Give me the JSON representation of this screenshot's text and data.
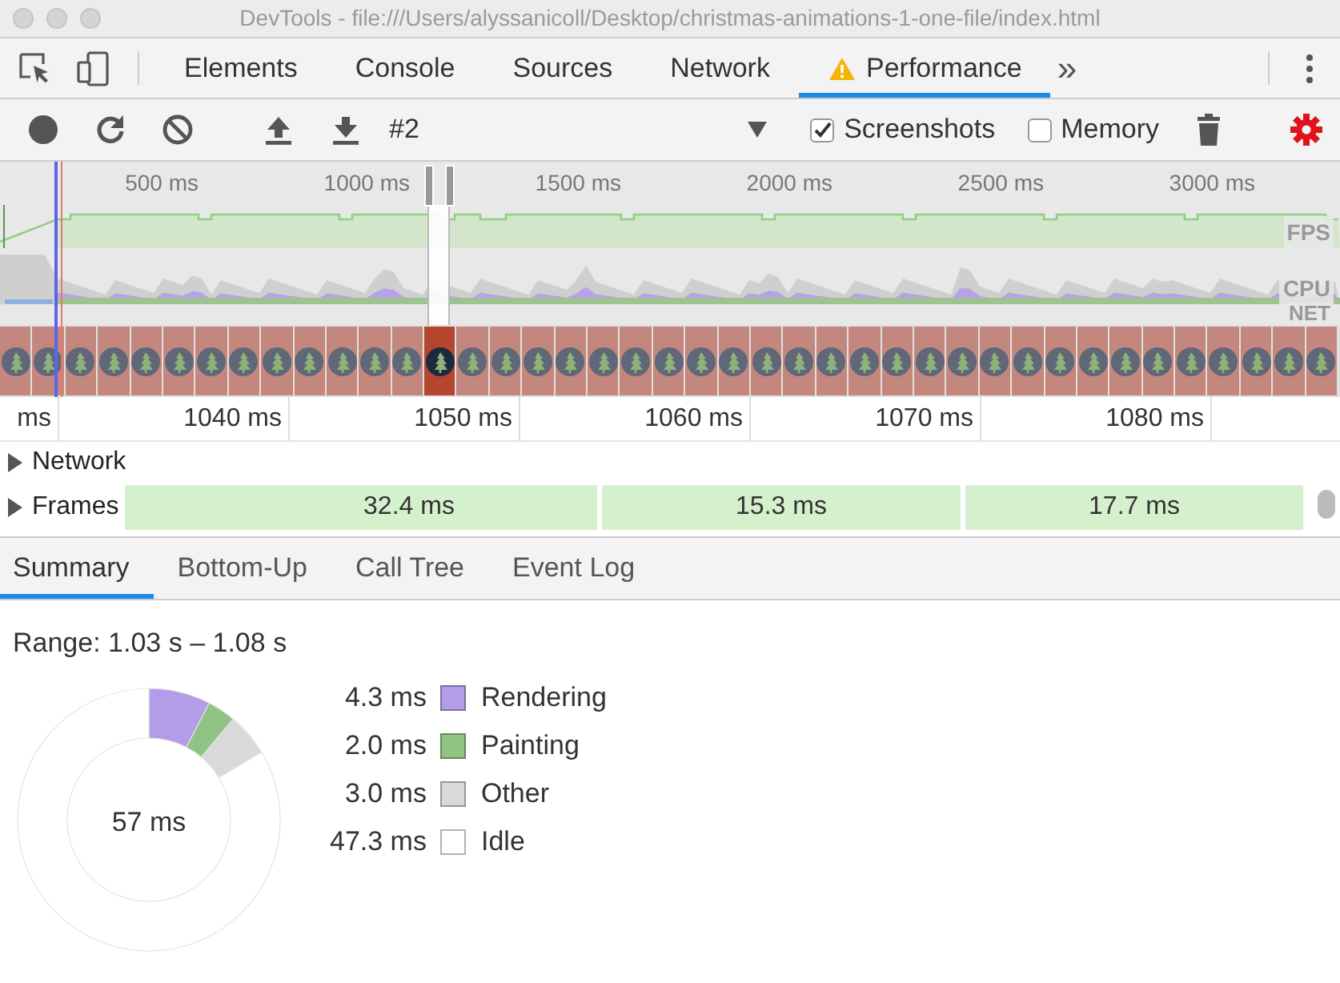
{
  "window": {
    "title": "DevTools - file:///Users/alyssanicoll/Desktop/christmas-animations-1-one-file/index.html"
  },
  "tabs": [
    {
      "label": "Elements",
      "selected": false,
      "warning": false
    },
    {
      "label": "Console",
      "selected": false,
      "warning": false
    },
    {
      "label": "Sources",
      "selected": false,
      "warning": false
    },
    {
      "label": "Network",
      "selected": false,
      "warning": false
    },
    {
      "label": "Performance",
      "selected": true,
      "warning": true
    }
  ],
  "more_tabs": "»",
  "toolbar": {
    "recording": "#2",
    "screenshots": {
      "label": "Screenshots",
      "checked": true
    },
    "memory": {
      "label": "Memory",
      "checked": false
    }
  },
  "overview": {
    "time_labels": [
      "500 ms",
      "1000 ms",
      "1500 ms",
      "2000 ms",
      "2500 ms",
      "3000 ms"
    ],
    "track_labels": [
      "FPS",
      "CPU",
      "NET"
    ],
    "screenshots": [
      {
        "selected": false
      },
      {
        "selected": false
      },
      {
        "selected": false
      },
      {
        "selected": false
      },
      {
        "selected": false
      },
      {
        "selected": false
      },
      {
        "selected": false
      },
      {
        "selected": false
      },
      {
        "selected": false
      },
      {
        "selected": false
      },
      {
        "selected": false
      },
      {
        "selected": false
      },
      {
        "selected": false
      },
      {
        "selected": true
      },
      {
        "selected": false
      },
      {
        "selected": false
      },
      {
        "selected": false
      },
      {
        "selected": false
      },
      {
        "selected": false
      },
      {
        "selected": false
      },
      {
        "selected": false
      },
      {
        "selected": false
      },
      {
        "selected": false
      },
      {
        "selected": false
      },
      {
        "selected": false
      },
      {
        "selected": false
      },
      {
        "selected": false
      },
      {
        "selected": false
      },
      {
        "selected": false
      },
      {
        "selected": false
      },
      {
        "selected": false
      },
      {
        "selected": false
      },
      {
        "selected": false
      },
      {
        "selected": false
      },
      {
        "selected": false
      },
      {
        "selected": false
      },
      {
        "selected": false
      },
      {
        "selected": false
      },
      {
        "selected": false
      },
      {
        "selected": false
      },
      {
        "selected": false
      }
    ]
  },
  "timeline": {
    "ruler": [
      "ms",
      "1040 ms",
      "1050 ms",
      "1060 ms",
      "1070 ms",
      "1080 ms"
    ],
    "tracks": [
      {
        "label": "Network",
        "expanded": false
      },
      {
        "label": "Frames",
        "expanded": false
      }
    ],
    "frames": [
      {
        "label": "32.4 ms"
      },
      {
        "label": "15.3 ms"
      },
      {
        "label": "17.7 ms"
      }
    ]
  },
  "details": {
    "tabs": [
      {
        "label": "Summary",
        "selected": true
      },
      {
        "label": "Bottom-Up",
        "selected": false
      },
      {
        "label": "Call Tree",
        "selected": false
      },
      {
        "label": "Event Log",
        "selected": false
      }
    ],
    "range": "Range: 1.03 s – 1.08 s",
    "total": "57 ms",
    "legend": [
      {
        "value": "4.3 ms",
        "color": "#b39ce8"
      },
      {
        "value": "2.0 ms",
        "color": "#8fc485"
      },
      {
        "value": "3.0 ms",
        "color": "#d9d9d9"
      },
      {
        "value": "47.3 ms",
        "color": "#ffffff"
      }
    ],
    "chart_data": {
      "type": "donut",
      "categories": [
        "Rendering",
        "Painting",
        "Other",
        "Idle"
      ],
      "values": [
        7.6,
        3.5,
        5.3,
        83.6
      ]
    }
  }
}
